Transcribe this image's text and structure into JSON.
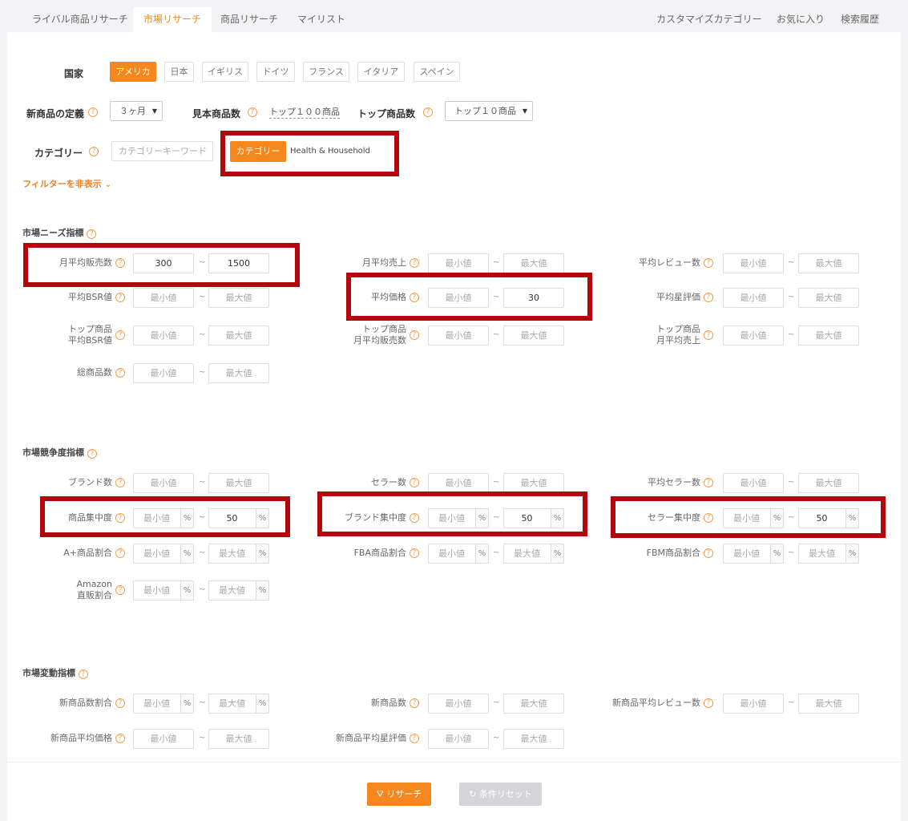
{
  "tabs": [
    {
      "label": "ライバル商品リサーチ",
      "active": false
    },
    {
      "label": "市場リサーチ",
      "active": true
    },
    {
      "label": "商品リサーチ",
      "active": false
    },
    {
      "label": "マイリスト",
      "active": false
    }
  ],
  "right_tabs": [
    "カスタマイズカテゴリー",
    "お気に入り",
    "検索履歴"
  ],
  "country": {
    "label": "国家",
    "options": [
      "アメリカ",
      "日本",
      "イギリス",
      "ドイツ",
      "フランス",
      "イタリア",
      "スペイン"
    ],
    "selected": "アメリカ"
  },
  "new_def": {
    "label": "新商品の定義",
    "value": "３ヶ月"
  },
  "sample": {
    "label": "見本商品数",
    "value": "トップ１００商品"
  },
  "top_count": {
    "label": "トップ商品数",
    "value": "トップ１０商品"
  },
  "category": {
    "label": "カテゴリー",
    "keyword_placeholder": "カテゴリーキーワード",
    "tag_label": "カテゴリー",
    "selected": "Health & Household"
  },
  "hide_filter": "フィルターを非表示",
  "placeholders": {
    "min": "最小値",
    "max": "最大値",
    "percent": "%"
  },
  "sections": {
    "needs": "市場ニーズ指標",
    "competition": "市場競争度指標",
    "change": "市場変動指標"
  },
  "fields": {
    "monthly_sales": {
      "label": "月平均販売数",
      "min": "300",
      "max": "1500"
    },
    "monthly_revenue": {
      "label": "月平均売上"
    },
    "avg_reviews": {
      "label": "平均レビュー数"
    },
    "avg_bsr": {
      "label": "平均BSR値"
    },
    "avg_price": {
      "label": "平均価格",
      "max": "30"
    },
    "avg_rating": {
      "label": "平均星評価"
    },
    "top_bsr": {
      "label1": "トップ商品",
      "label2": "平均BSR値"
    },
    "top_sales": {
      "label1": "トップ商品",
      "label2": "月平均販売数"
    },
    "top_revenue": {
      "label1": "トップ商品",
      "label2": "月平均売上"
    },
    "total_products": {
      "label": "総商品数"
    },
    "brands": {
      "label": "ブランド数"
    },
    "sellers": {
      "label": "セラー数"
    },
    "avg_sellers": {
      "label": "平均セラー数"
    },
    "product_conc": {
      "label": "商品集中度",
      "max": "50"
    },
    "brand_conc": {
      "label": "ブランド集中度",
      "max": "50"
    },
    "seller_conc": {
      "label": "セラー集中度",
      "max": "50"
    },
    "aplus": {
      "label": "A+商品割合"
    },
    "fba": {
      "label": "FBA商品割合"
    },
    "fbm": {
      "label": "FBM商品割合"
    },
    "amazon_direct": {
      "label1": "Amazon",
      "label2": "直販割合"
    },
    "new_ratio": {
      "label": "新商品数割合"
    },
    "new_count": {
      "label": "新商品数"
    },
    "new_avg_reviews": {
      "label": "新商品平均レビュー数"
    },
    "new_avg_price": {
      "label": "新商品平均価格"
    },
    "new_avg_rating": {
      "label": "新商品平均星評価"
    }
  },
  "buttons": {
    "research": "リサーチ",
    "reset": "条件リセット"
  },
  "colors": {
    "accent": "#f5871f",
    "highlight": "#b5050d"
  }
}
